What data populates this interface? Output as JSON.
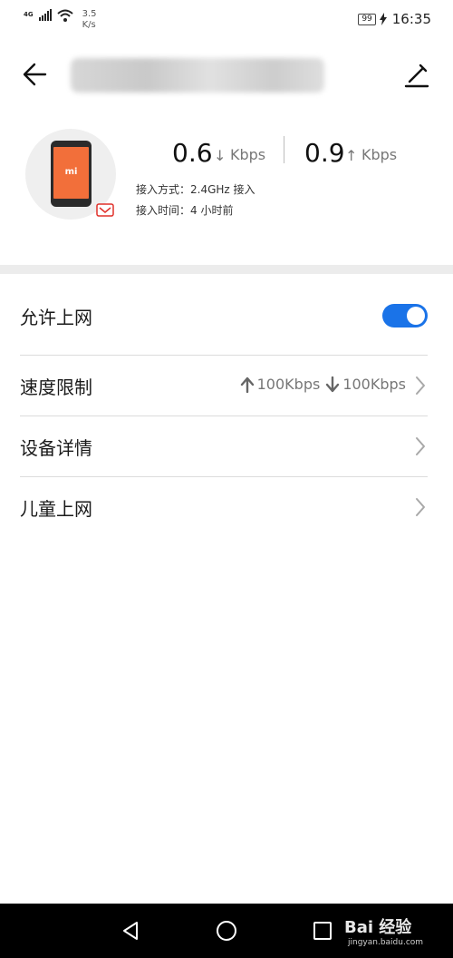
{
  "status_bar": {
    "network": "4G",
    "net_speed_value": "3.5",
    "net_speed_unit": "K/s",
    "battery": "99",
    "time": "16:35"
  },
  "header": {
    "title": "",
    "back_icon": "arrow-left-icon",
    "edit_icon": "pencil-icon"
  },
  "device": {
    "download": {
      "value": "0.6",
      "arrow": "↓",
      "unit": "Kbps"
    },
    "upload": {
      "value": "0.9",
      "arrow": "↑",
      "unit": "Kbps"
    },
    "access_method_label": "接入方式：",
    "access_method_value": "2.4GHz 接入",
    "access_time_label": "接入时间：",
    "access_time_value": "4 小时前",
    "phone_logo": "mi",
    "badge_icon": "wifi-badge-icon"
  },
  "settings": {
    "allow_internet": {
      "label": "允许上网",
      "enabled": true
    },
    "speed_limit": {
      "label": "速度限制",
      "up": "100Kbps",
      "down": "100Kbps"
    },
    "device_details": {
      "label": "设备详情"
    },
    "child_mode": {
      "label": "儿童上网"
    }
  },
  "nav": {
    "back_icon": "triangle-back-icon",
    "home_icon": "circle-home-icon",
    "recent_icon": "square-recents-icon"
  },
  "watermark": {
    "brand": "Bai 经验",
    "site": "jingyan.baidu.com"
  },
  "colors": {
    "accent": "#1a73e8",
    "phone_screen": "#f26f3a",
    "badge": "#e0302a"
  }
}
